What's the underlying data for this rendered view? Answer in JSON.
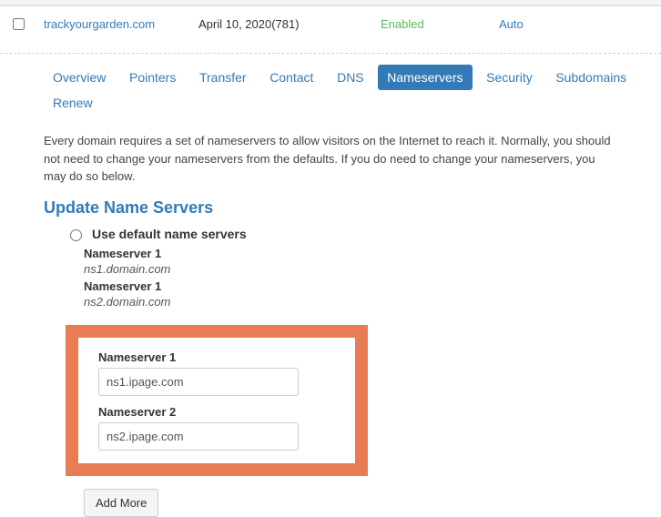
{
  "rows": [
    {
      "domain": "trackyourgarden.com",
      "date": "April 10, 2020(781)",
      "status": "Enabled",
      "action": "Auto"
    }
  ],
  "tabs": [
    "Overview",
    "Pointers",
    "Transfer",
    "Contact",
    "DNS",
    "Nameservers",
    "Security",
    "Subdomains",
    "Renew"
  ],
  "activeTab": "Nameservers",
  "description": "Every domain requires a set of nameservers to allow visitors on the Internet to reach it. Normally, you should not need to change your nameservers from the defaults. If you do need to change your nameservers, you may do so below.",
  "sectionTitle": "Update Name Servers",
  "defaultOptionLabel": "Use default name servers",
  "defaults": {
    "ns1Label": "Nameserver 1",
    "ns1Value": "ns1.domain.com",
    "ns2Label": "Nameserver 1",
    "ns2Value": "ns2.domain.com"
  },
  "custom": {
    "ns1Label": "Nameserver 1",
    "ns1Value": "ns1.ipage.com",
    "ns2Label": "Nameserver 2",
    "ns2Value": "ns2.ipage.com"
  },
  "addMoreLabel": "Add More"
}
